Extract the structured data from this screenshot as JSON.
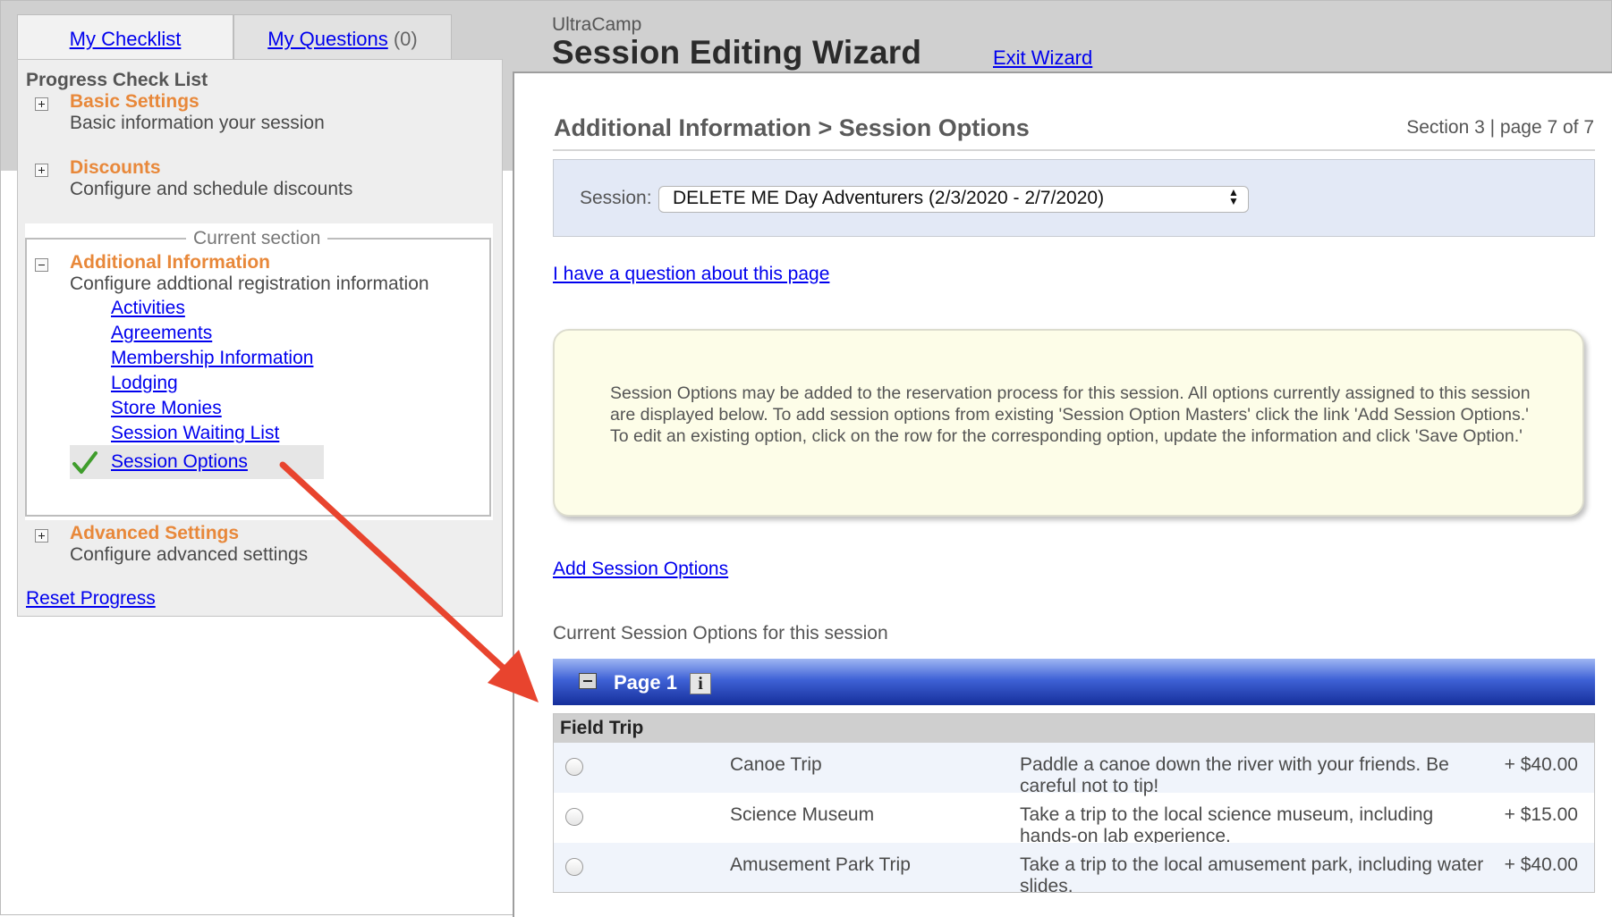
{
  "tabs": {
    "checklist_label": "My Checklist",
    "questions_label": "My Questions",
    "questions_count": "(0)"
  },
  "header": {
    "brand": "UltraCamp",
    "title": "Session Editing Wizard",
    "exit_label": "Exit Wizard"
  },
  "sidebar": {
    "title": "Progress Check List",
    "current_section_legend": "Current section",
    "sections": [
      {
        "title": "Basic Settings",
        "description": "Basic information your session"
      },
      {
        "title": "Discounts",
        "description": "Configure and schedule discounts"
      },
      {
        "title": "Additional Information",
        "description": "Configure addtional registration information"
      },
      {
        "title": "Advanced Settings",
        "description": "Configure advanced settings"
      }
    ],
    "sub_links": [
      "Activities",
      "Agreements",
      "Membership Information",
      "Lodging",
      "Store Monies",
      "Session Waiting List",
      "Session Options"
    ],
    "active_item": "Session Options",
    "reset_label": "Reset Progress"
  },
  "main": {
    "breadcrumb": "Additional Information > Session Options",
    "section_info": "Section 3 | page 7 of 7",
    "session_label": "Session:",
    "session_value": "DELETE ME Day Adventurers (2/3/2020 - 2/7/2020)",
    "question_link": "I have a question about this page",
    "info_text": "Session Options may be added to the reservation process for this session. All options currently assigned to this session are displayed below. To add session options from existing 'Session Option Masters' click the link 'Add Session Options.' To edit an existing option, click on the row for the corresponding option, update the information and click 'Save Option.'",
    "add_link": "Add Session Options",
    "current_label": "Current Session Options for this session",
    "page_label": "Page 1",
    "page_info_glyph": "i",
    "group_label": "Field Trip",
    "options": [
      {
        "name": "Canoe Trip",
        "description": "Paddle a canoe down the river with your friends. Be careful not to tip!",
        "price": "+ $40.00"
      },
      {
        "name": "Science Museum",
        "description": "Take a trip to the local science museum, including hands-on lab experience.",
        "price": "+ $15.00"
      },
      {
        "name": "Amusement Park Trip",
        "description": "Take a trip to the local amusement park, including water slides.",
        "price": "+ $40.00"
      }
    ]
  },
  "colors": {
    "section_title": "#e8883a",
    "link": "#0000ee",
    "page_header": "#1f3aa8",
    "annotation_arrow": "#e8442e",
    "checkmark": "#3f9d2c"
  },
  "icons": {
    "expand": "plus-box-icon",
    "collapse": "minus-box-icon",
    "done": "checkmark-icon",
    "info": "info-icon",
    "select": "updown-arrows-icon"
  }
}
